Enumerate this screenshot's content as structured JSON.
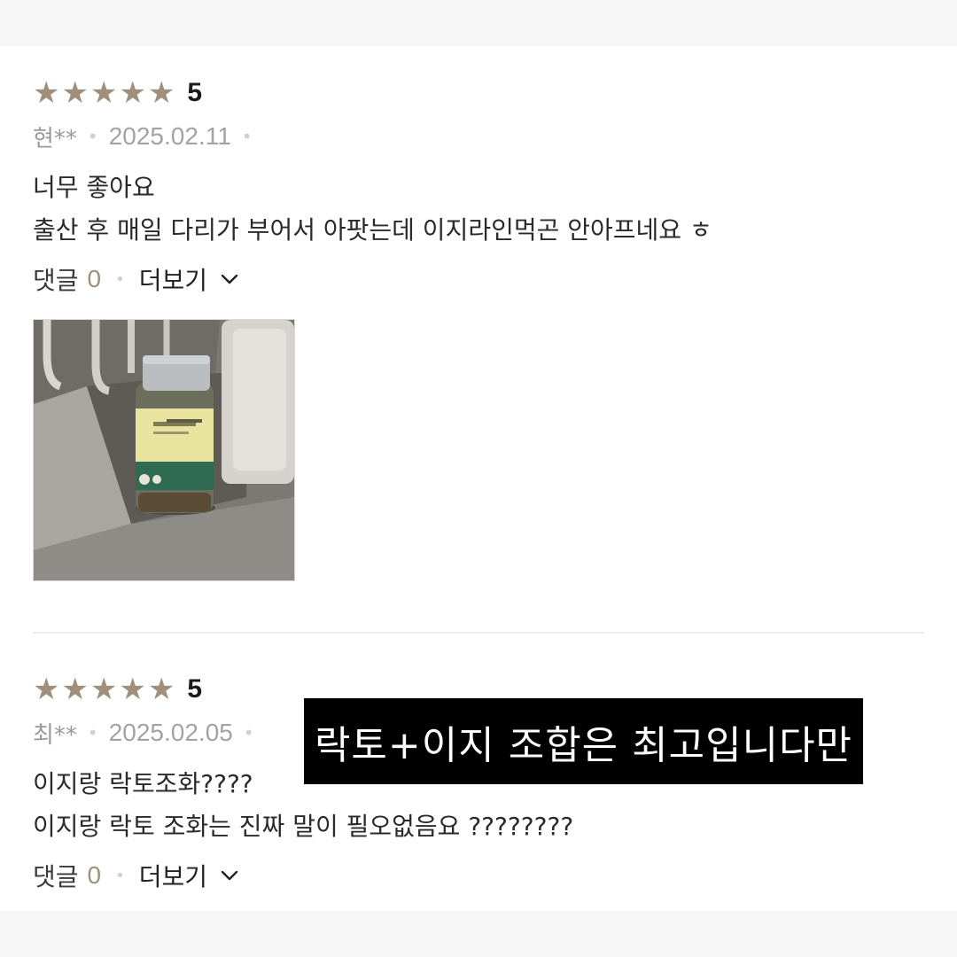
{
  "reviews": [
    {
      "stars": [
        "★",
        "★",
        "★",
        "★",
        "★"
      ],
      "score": "5",
      "author": "현**",
      "date": "2025.02.11",
      "lines": [
        "너무 좋아요",
        "출산 후 매일 다리가 부어서 아팟는데 이지라인먹곤 안아프네요 ㅎ"
      ],
      "comments_label": "댓글",
      "comments_count": "0",
      "more_label": "더보기"
    },
    {
      "stars": [
        "★",
        "★",
        "★",
        "★",
        "★"
      ],
      "score": "5",
      "author": "최**",
      "date": "2025.02.05",
      "lines": [
        "이지랑 락토조화????",
        "이지랑 락토 조화는 진짜 말이 필오없음요 ????????"
      ],
      "comments_label": "댓글",
      "comments_count": "0",
      "more_label": "더보기"
    }
  ],
  "overlay_caption": "락토+이지 조합은 최고입니다만",
  "colors": {
    "star": "#a08f7d",
    "background": "#f6f6f6",
    "card": "#ffffff",
    "overlay_bg": "#000000"
  },
  "icons": {
    "star": "star-icon",
    "chevron": "chevron-down-icon"
  }
}
